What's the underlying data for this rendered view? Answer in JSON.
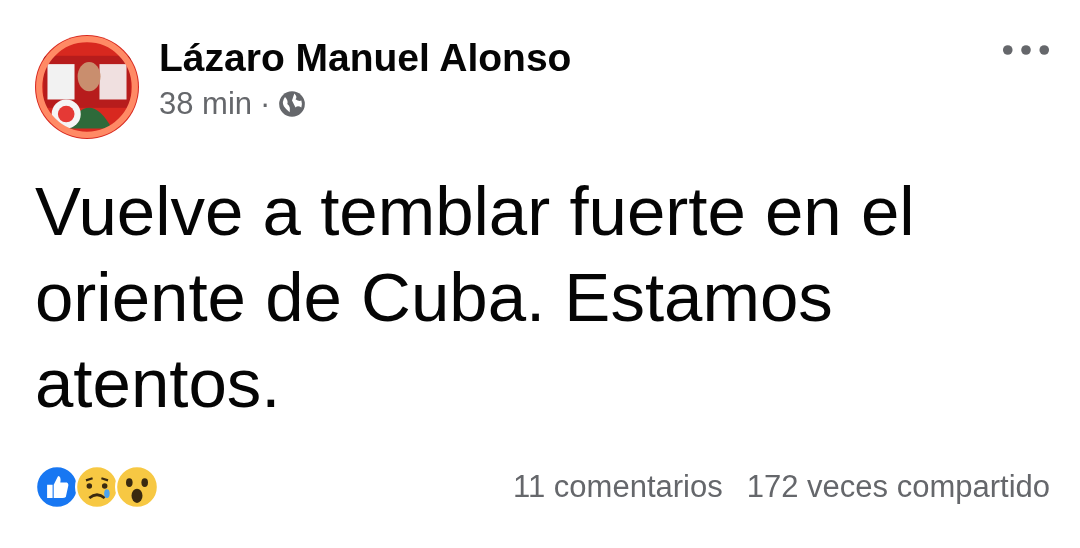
{
  "post": {
    "author": "Lázaro Manuel Alonso",
    "time": "38 min",
    "separator": "·",
    "text": "Vuelve a temblar fuerte en el oriente de Cuba. Estamos atentos.",
    "comments": "11 comentarios",
    "shares": "172 veces compartido"
  }
}
